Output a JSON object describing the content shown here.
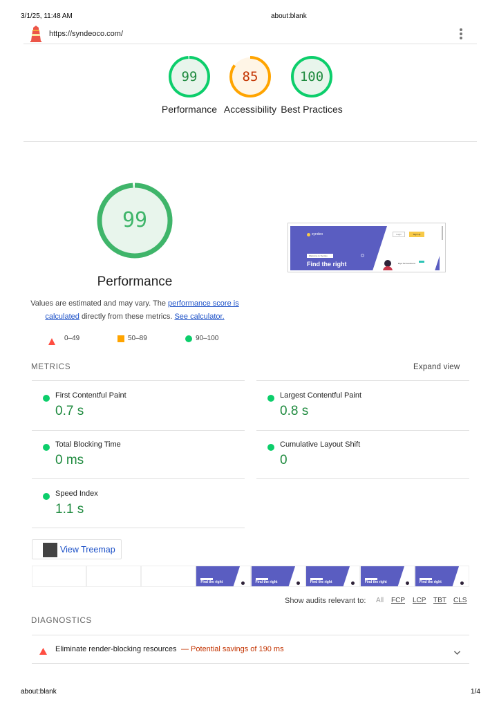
{
  "print_header": {
    "datetime": "3/1/25, 11:48 AM",
    "title": "about:blank"
  },
  "print_footer": {
    "url": "about:blank",
    "page": "1/4"
  },
  "topbar": {
    "url": "https://syndeoco.com/",
    "logo_icon": "lighthouse-icon",
    "menu_icon": "kebab-menu-icon"
  },
  "gauges": [
    {
      "score": "99",
      "label": "Performance",
      "color": "#0cce6b",
      "fraction": 0.99
    },
    {
      "score": "85",
      "label": "Accessibility",
      "color": "#ffa400",
      "fraction": 0.85
    },
    {
      "score": "100",
      "label": "Best Practices",
      "color": "#0cce6b",
      "fraction": 1.0
    }
  ],
  "performance": {
    "score": "99",
    "title": "Performance",
    "description_pre": "Values are estimated and may vary. The ",
    "link1": "performance score is calculated",
    "description_mid": " directly from these metrics. ",
    "link2": "See calculator.",
    "legend": [
      "0–49",
      "50–89",
      "90–100"
    ]
  },
  "screenshot": {
    "brand": "syndeo",
    "login": "Login",
    "signup": "Sign Up",
    "badge": "Welcome to Syndeo",
    "headline": "Find the right",
    "card_name": "Elya Tai Gesboens"
  },
  "metrics": {
    "title": "METRICS",
    "expand": "Expand view",
    "items": [
      {
        "label": "First Contentful Paint",
        "value": "0.7 s"
      },
      {
        "label": "Largest Contentful Paint",
        "value": "0.8 s"
      },
      {
        "label": "Total Blocking Time",
        "value": "0 ms"
      },
      {
        "label": "Cumulative Layout Shift",
        "value": "0"
      },
      {
        "label": "Speed Index",
        "value": "1.1 s"
      }
    ]
  },
  "treemap": {
    "label": "View Treemap"
  },
  "filmstrip": {
    "frame_text": "Find the right",
    "frames_filled": [
      false,
      false,
      false,
      true,
      true,
      true,
      true,
      true
    ]
  },
  "audit_filter": {
    "label": "Show audits relevant to:",
    "options": [
      "All",
      "FCP",
      "LCP",
      "TBT",
      "CLS"
    ]
  },
  "diagnostics": {
    "title": "DIAGNOSTICS",
    "items": [
      {
        "title": "Eliminate render-blocking resources",
        "savings": "— Potential savings of 190 ms",
        "status_color": "#ff4e42"
      }
    ]
  }
}
